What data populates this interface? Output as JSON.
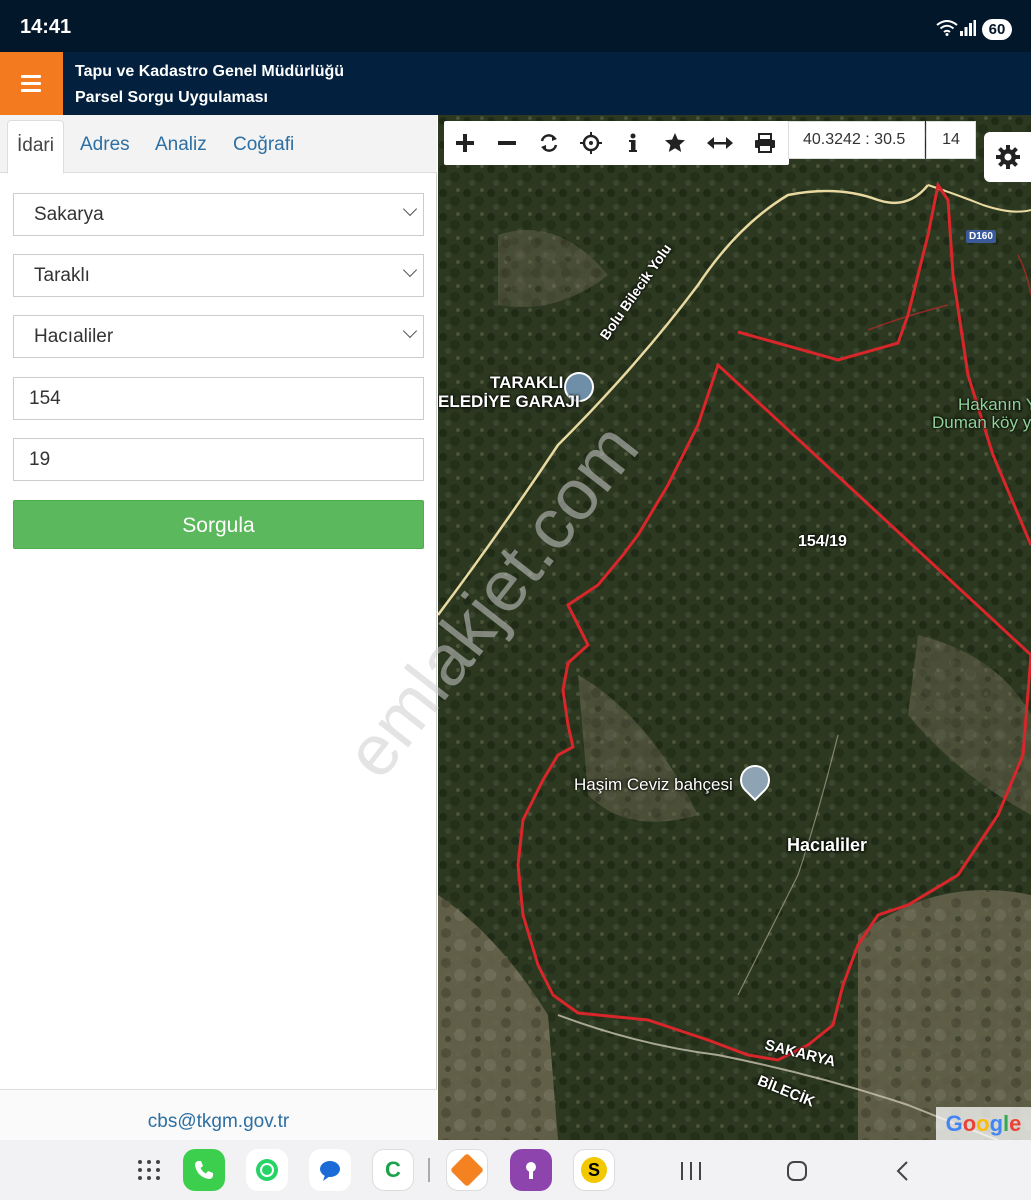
{
  "status_bar": {
    "time": "14:41",
    "battery": "60"
  },
  "header": {
    "line1": "Tapu ve Kadastro Genel Müdürlüğü",
    "line2": "Parsel Sorgu Uygulaması"
  },
  "tabs": [
    {
      "label": "İdari",
      "active": true
    },
    {
      "label": "Adres"
    },
    {
      "label": "Analiz"
    },
    {
      "label": "Coğrafi"
    }
  ],
  "form": {
    "province": "Sakarya",
    "district": "Taraklı",
    "neighborhood": "Hacıaliler",
    "block": "154",
    "parcel": "19",
    "submit_label": "Sorgula"
  },
  "footer": {
    "email": "cbs@tkgm.gov.tr"
  },
  "watermark": "emlakjet.com",
  "map": {
    "coords": "40.3242 : 30.5",
    "zoom": "14",
    "labels": {
      "parcel": "154/19",
      "place_hacialiler": "Hacıaliler",
      "poi_ceviz": "Haşim Ceviz bahçesi",
      "poi_garaj_1": "TARAKLI",
      "poi_garaj_2": "ELEDİYE GARAJI",
      "road": "Bolu Bilecik Yolu",
      "hakanin_1": "Hakanın Y",
      "hakanin_2": "Duman köy y",
      "sakarya": "SAKARYA",
      "bilecik": "BİLECİK",
      "d160": "D160",
      "google": "Google"
    },
    "parcel_border_color": "#d8262b"
  },
  "colors": {
    "status_bar": "#03172b",
    "app_header": "#03213e",
    "menu_button": "#f47a20",
    "submit": "#5cb85c",
    "tab_link": "#2d6fa3"
  }
}
